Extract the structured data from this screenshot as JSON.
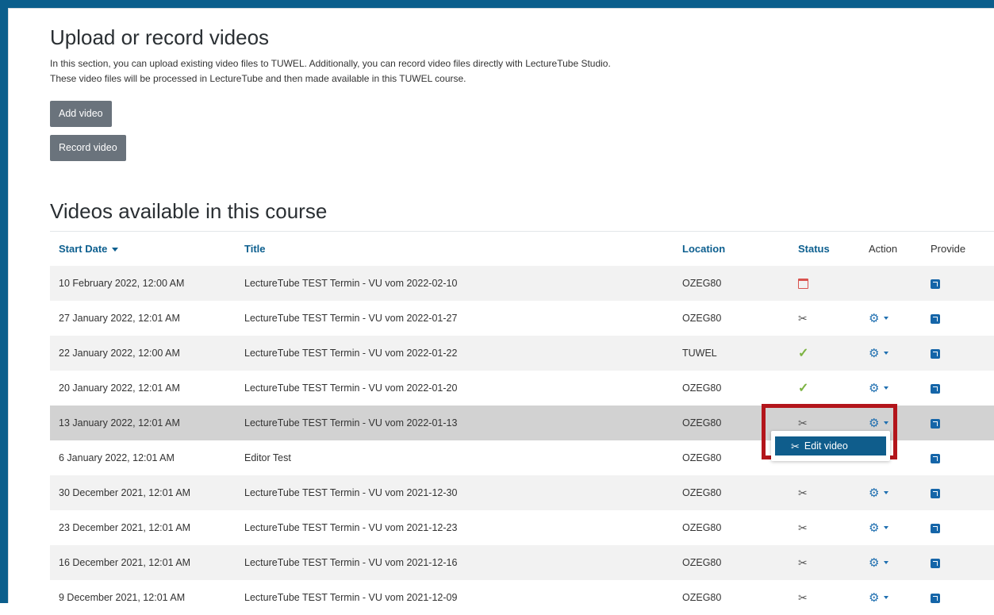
{
  "upload_section": {
    "title": "Upload or record videos",
    "description_line1": "In this section, you can upload existing video files to TUWEL. Additionally, you can record video files directly with LectureTube Studio.",
    "description_line2": "These video files will be processed in LectureTube and then made available in this TUWEL course.",
    "add_video_label": "Add video",
    "record_video_label": "Record video"
  },
  "videos_section": {
    "title": "Videos available in this course",
    "columns": {
      "start_date": "Start Date",
      "title": "Title",
      "location": "Location",
      "status": "Status",
      "action": "Action",
      "provide": "Provide"
    },
    "rows": [
      {
        "date": "10 February 2022, 12:00 AM",
        "title": "LectureTube TEST Termin - VU vom 2022-02-10",
        "location": "OZEG80",
        "status_icon": "calendar-icon",
        "action": false
      },
      {
        "date": "27 January 2022, 12:01 AM",
        "title": "LectureTube TEST Termin - VU vom 2022-01-27",
        "location": "OZEG80",
        "status_icon": "scissors-icon",
        "action": true
      },
      {
        "date": "22 January 2022, 12:00 AM",
        "title": "LectureTube TEST Termin - VU vom 2022-01-22",
        "location": "TUWEL",
        "status_icon": "check-icon",
        "action": true
      },
      {
        "date": "20 January 2022, 12:01 AM",
        "title": "LectureTube TEST Termin - VU vom 2022-01-20",
        "location": "OZEG80",
        "status_icon": "check-icon",
        "action": true
      },
      {
        "date": "13 January 2022, 12:01 AM",
        "title": "LectureTube TEST Termin - VU vom 2022-01-13",
        "location": "OZEG80",
        "status_icon": "scissors-icon",
        "action": true
      },
      {
        "date": "6 January 2022, 12:01 AM",
        "title": "Editor Test",
        "location": "OZEG80",
        "status_icon": "check-icon",
        "action": false
      },
      {
        "date": "30 December 2021, 12:01 AM",
        "title": "LectureTube TEST Termin - VU vom 2021-12-30",
        "location": "OZEG80",
        "status_icon": "scissors-icon",
        "action": true
      },
      {
        "date": "23 December 2021, 12:01 AM",
        "title": "LectureTube TEST Termin - VU vom 2021-12-23",
        "location": "OZEG80",
        "status_icon": "scissors-icon",
        "action": true
      },
      {
        "date": "16 December 2021, 12:01 AM",
        "title": "LectureTube TEST Termin - VU vom 2021-12-16",
        "location": "OZEG80",
        "status_icon": "scissors-icon",
        "action": true
      },
      {
        "date": "9 December 2021, 12:01 AM",
        "title": "LectureTube TEST Termin - VU vom 2021-12-09",
        "location": "OZEG80",
        "status_icon": "scissors-icon",
        "action": true
      }
    ]
  },
  "action_menu": {
    "edit_video_label": "Edit video"
  },
  "colors": {
    "frame": "#0b5e8c",
    "link": "#0d5f8f",
    "button": "#6a737c",
    "highlight_box": "#b3151b",
    "menu_active": "#0f5d8c"
  }
}
